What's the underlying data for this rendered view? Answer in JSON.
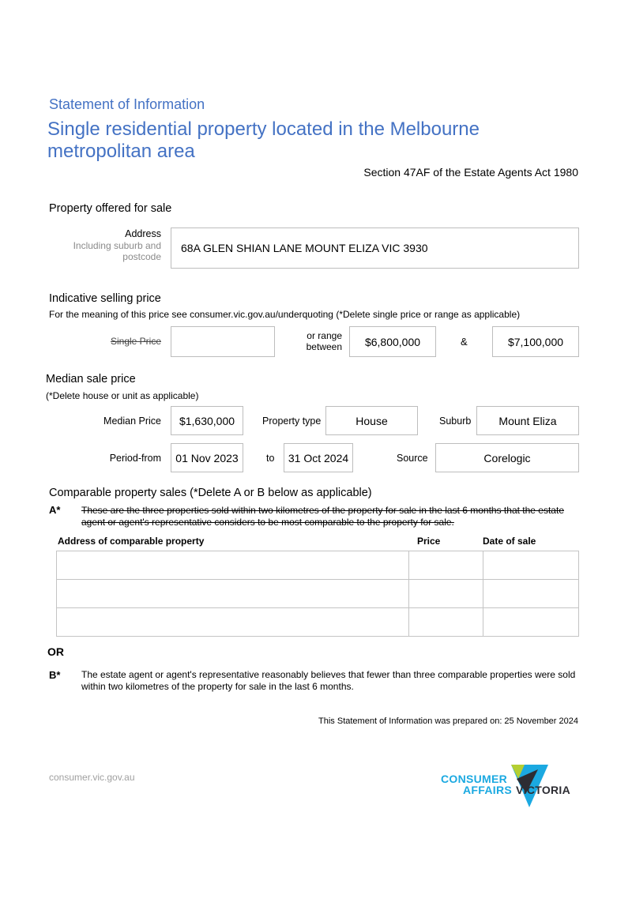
{
  "header": {
    "subtitle": "Statement of Information",
    "title": "Single residential property located in the Melbourne metropolitan area",
    "act": "Section 47AF of the Estate Agents Act 1980"
  },
  "property": {
    "heading": "Property offered for sale",
    "address_label": "Address",
    "address_sublabel_1": "Including suburb and",
    "address_sublabel_2": "postcode",
    "address_value": "68A GLEN SHIAN LANE MOUNT ELIZA VIC 3930"
  },
  "indicative": {
    "heading": "Indicative selling price",
    "note": "For the meaning of this price see consumer.vic.gov.au/underquoting (*Delete single price or range as applicable)",
    "single_price_label": "Single Price",
    "single_price_value": "",
    "range_label_1": "or range",
    "range_label_2": "between",
    "range_low": "$6,800,000",
    "range_sep": "&",
    "range_high": "$7,100,000"
  },
  "median": {
    "heading": "Median sale price",
    "note": "(*Delete house or unit as applicable)",
    "median_price_label": "Median Price",
    "median_price_value": "$1,630,000",
    "property_type_label": "Property type",
    "property_type_value": "House",
    "suburb_label": "Suburb",
    "suburb_value": "Mount Eliza",
    "period_from_label": "Period-from",
    "period_from_value": "01 Nov 2023",
    "to_label": "to",
    "period_to_value": "31 Oct 2024",
    "source_label": "Source",
    "source_value": "Corelogic"
  },
  "comparable": {
    "heading": "Comparable property sales (*Delete A or B below as applicable)",
    "a_marker": "A*",
    "a_text": "These are the three properties sold within two kilometres of the property for sale in the last 6 months that the estate agent or agent's representative considers to be most comparable to the property for sale.",
    "columns": [
      "Address of comparable property",
      "Price",
      "Date of sale"
    ],
    "rows": [
      [
        "",
        "",
        ""
      ],
      [
        "",
        "",
        ""
      ],
      [
        "",
        "",
        ""
      ]
    ],
    "or_label": "OR",
    "b_marker": "B*",
    "b_text": "The estate agent or agent's representative reasonably believes that fewer than three comparable properties were sold within two kilometres of the property for sale in the last 6 months."
  },
  "prepared": "This Statement of Information was prepared on: 25 November 2024",
  "footer": {
    "url": "consumer.vic.gov.au",
    "logo_line1": "CONSUMER",
    "logo_line2": "AFFAIRS",
    "logo_word": "VICTORIA",
    "brand_colors": {
      "cyan": "#1ba9e1",
      "lime": "#b5cf32",
      "dark": "#2d2d33"
    }
  }
}
